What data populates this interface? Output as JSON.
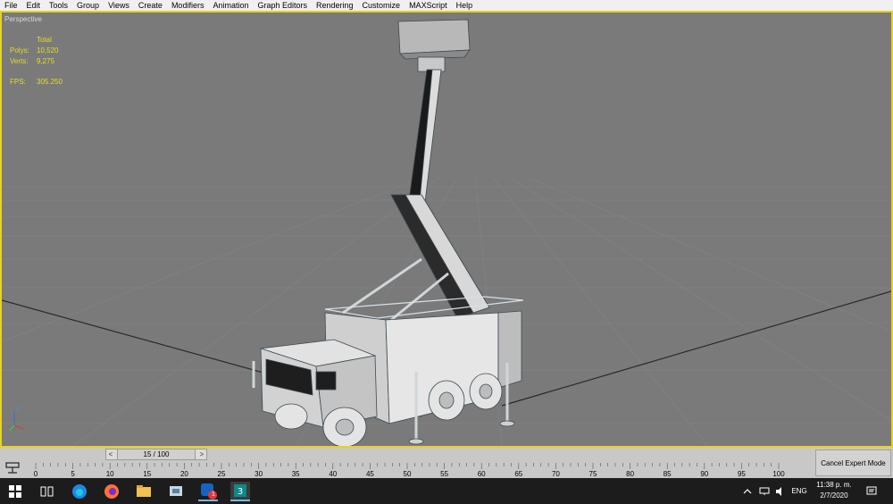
{
  "menu": [
    "File",
    "Edit",
    "Tools",
    "Group",
    "Views",
    "Create",
    "Modifiers",
    "Animation",
    "Graph Editors",
    "Rendering",
    "Customize",
    "MAXScript",
    "Help"
  ],
  "viewport": {
    "label": "Perspective",
    "stats_header": "Total",
    "polys_label": "Polys:",
    "polys_value": "10,520",
    "verts_label": "Verts:",
    "verts_value": "9,275",
    "fps_label": "FPS:",
    "fps_value": "305.250",
    "gizmo_axis": "z"
  },
  "timeline": {
    "frame": "15 / 100",
    "prev_arrow": "<",
    "next_arrow": ">",
    "ticks": [
      "0",
      "5",
      "10",
      "15",
      "20",
      "25",
      "30",
      "35",
      "40",
      "45",
      "50",
      "55",
      "60",
      "65",
      "70",
      "75",
      "80",
      "85",
      "90",
      "95",
      "100"
    ]
  },
  "expert_mode_label": "Cancel Expert Mode",
  "taskbar": {
    "icons": [
      "windows-start-icon",
      "task-view-icon",
      "edge-icon",
      "firefox-icon",
      "file-explorer-icon",
      "app-icon",
      "notification-app-icon",
      "3dsmax-icon"
    ],
    "badge": "1",
    "language": "ENG",
    "time": "11:38 p. m.",
    "date": "2/7/2020"
  },
  "colors": {
    "viewport_bg": "#7a7a7a",
    "viewport_border": "#e7d21e",
    "stats_text": "#e6dc28",
    "taskbar_bg": "#1c1c1c"
  }
}
